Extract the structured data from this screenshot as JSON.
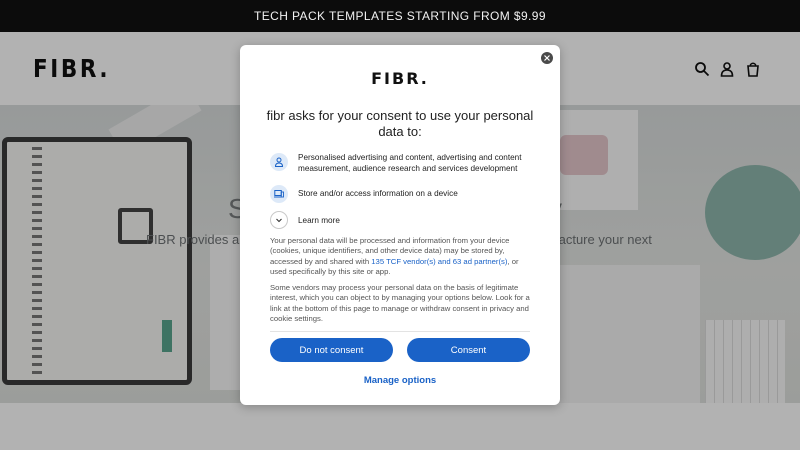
{
  "announcement": {
    "text": "TECH PACK TEMPLATES STARTING FROM $9.99"
  },
  "header": {
    "logo": "FIBR.",
    "icons": {
      "search": "search-icon",
      "account": "account-icon",
      "cart": "cart-icon"
    }
  },
  "hero": {
    "title_left": "S",
    "title_right": "y",
    "subtitle_left": "FIBR provides a",
    "subtitle_right": "facture your next"
  },
  "consent": {
    "logo": "FIBR.",
    "title": "fibr asks for your consent to use your personal data to:",
    "purposes": [
      {
        "icon": "person-icon",
        "text": "Personalised advertising and content, advertising and content measurement, audience research and services development"
      },
      {
        "icon": "device-icon",
        "text": "Store and/or access information on a device"
      }
    ],
    "learn_more": "Learn more",
    "paragraph1_before": "Your personal data will be processed and information from your device (cookies, unique identifiers, and other device data) may be stored by, accessed by and shared with ",
    "paragraph1_link": "135 TCF vendor(s) and 63 ad partner(s)",
    "paragraph1_after": ", or used specifically by this site or app.",
    "paragraph2": "Some vendors may process your personal data on the basis of legitimate interest, which you can object to by managing your options below. Look for a link at the bottom of this page to manage or withdraw consent in privacy and cookie settings.",
    "do_not_consent": "Do not consent",
    "consent": "Consent",
    "manage_options": "Manage options"
  },
  "colors": {
    "accent": "#1a62c7",
    "announcement_bg": "#0c0c0c"
  }
}
